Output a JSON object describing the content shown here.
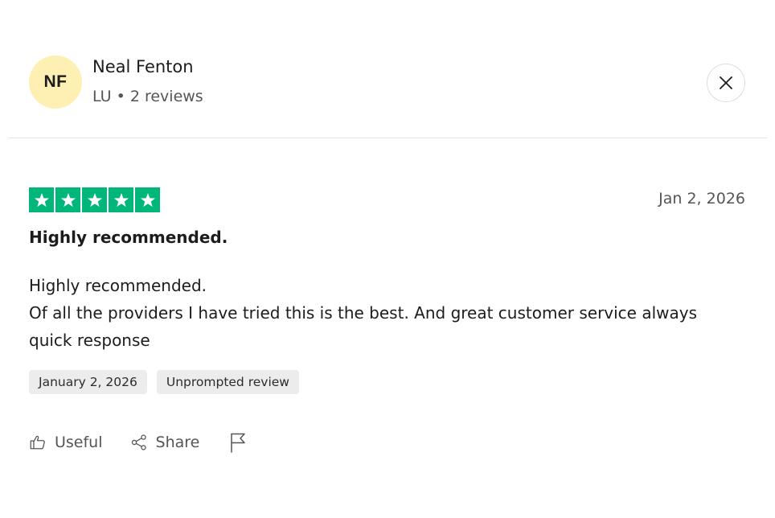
{
  "reviewer": {
    "initials": "NF",
    "name": "Neal Fenton",
    "meta": "LU • 2 reviews",
    "avatar_color": "#fdf0b2"
  },
  "close": {
    "icon": "close-icon"
  },
  "review": {
    "rating": 5,
    "star_color": "#00b67a",
    "date": "Jan 2, 2026",
    "title": "Highly recommended.",
    "body_lines": [
      "Highly recommended.",
      "Of all the providers I have tried this is the best. And great customer service always quick response"
    ]
  },
  "tags": {
    "date": "January 2, 2026",
    "source": "Unprompted review"
  },
  "actions": {
    "useful_label": "Useful",
    "useful_icon": "thumbs-up-icon",
    "share_label": "Share",
    "share_icon": "share-icon",
    "report_icon": "flag-icon"
  }
}
